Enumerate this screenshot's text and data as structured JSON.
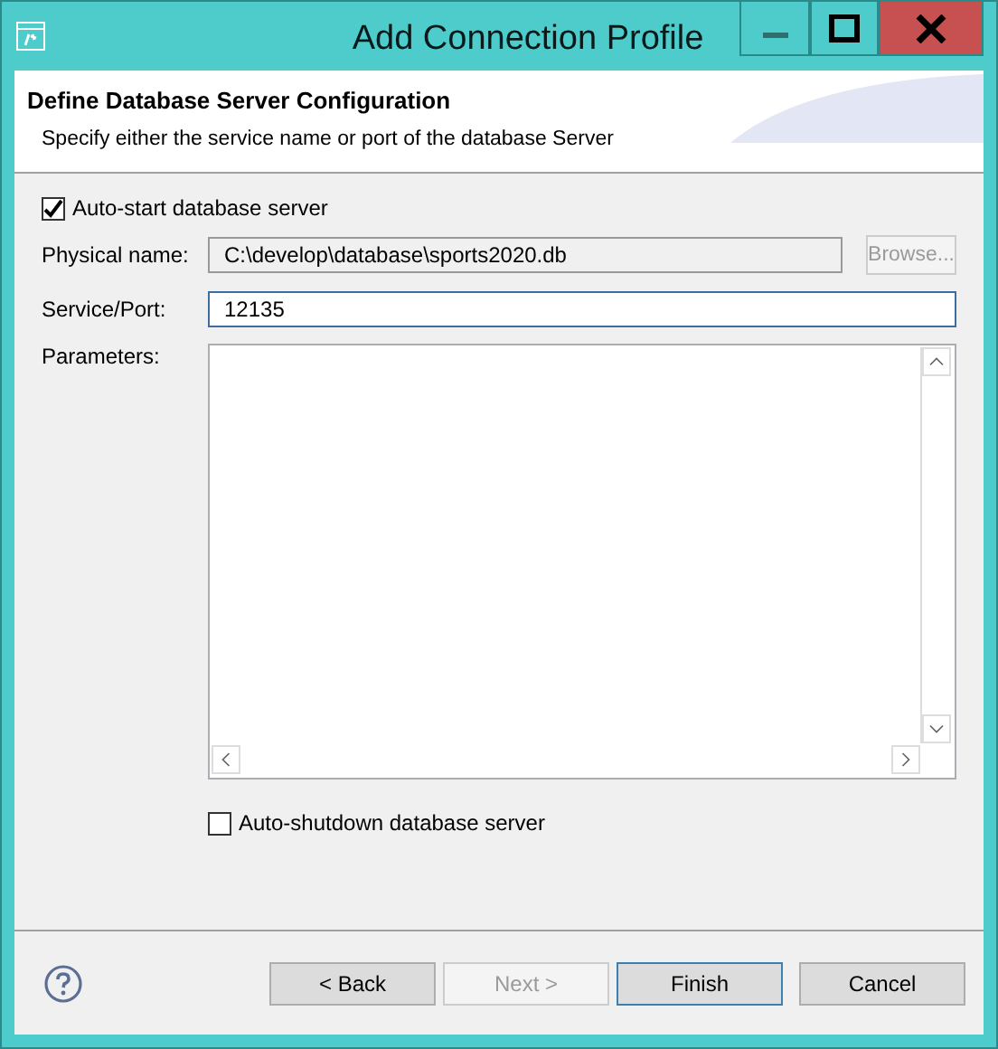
{
  "window": {
    "title": "Add Connection Profile"
  },
  "header": {
    "title": "Define Database Server Configuration",
    "description": "Specify either the service name or port of the database Server"
  },
  "auto_start": {
    "label": "Auto-start database server",
    "checked": true
  },
  "physical_name": {
    "label": "Physical name:",
    "value": "C:\\develop\\database\\sports2020.db",
    "disabled": true
  },
  "browse_button": {
    "label": "Browse...",
    "disabled": true
  },
  "service_port": {
    "label": "Service/Port:",
    "value": "12135"
  },
  "parameters": {
    "label": "Parameters:"
  },
  "auto_shutdown": {
    "label": "Auto-shutdown database server",
    "checked": false
  },
  "buttons": [
    {
      "label": "< Back",
      "disabled": false,
      "default": false
    },
    {
      "label": "Next >",
      "disabled": true,
      "default": false
    },
    {
      "label": "Finish",
      "disabled": false,
      "default": true
    },
    {
      "label": "Cancel",
      "disabled": false,
      "default": false
    }
  ]
}
